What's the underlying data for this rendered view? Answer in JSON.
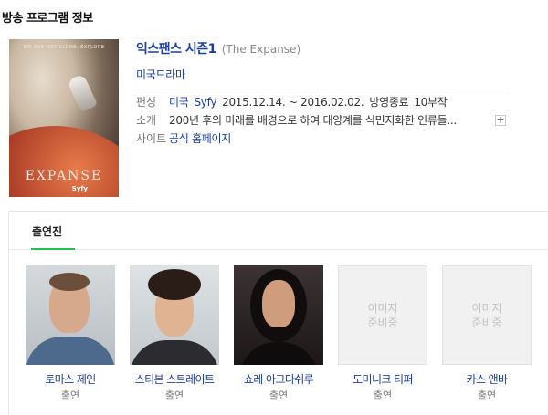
{
  "page": {
    "section_title": "방송 프로그램 정보"
  },
  "poster": {
    "tagline": "WE ARE NOT ALONE. EXPLORE",
    "logo": "EXPANSE",
    "network": "Syfy"
  },
  "program": {
    "title": "익스팬스 시즌1",
    "original_title": "(The Expanse)",
    "genre": "미국드라마"
  },
  "info": {
    "broadcast_label": "편성",
    "broadcast_country": "미국",
    "broadcast_channel": "Syfy",
    "broadcast_period": "2015.12.14. ~ 2016.02.02.",
    "broadcast_status": "방영종료",
    "broadcast_episodes": "10부작",
    "intro_label": "소개",
    "intro_text": "200년 후의 미래를 배경으로 하여 태양계를 식민지화한 인류들...",
    "more_icon_text": "+",
    "site_label": "사이트",
    "site_link": "공식 홈페이지"
  },
  "cast": {
    "tab_label": "출연진",
    "members": [
      {
        "name": "토마스 제인",
        "role": "출연",
        "has_photo": true
      },
      {
        "name": "스티븐 스트레이트",
        "role": "출연",
        "has_photo": true
      },
      {
        "name": "쇼레 아그다쉬루",
        "role": "출연",
        "has_photo": true
      },
      {
        "name": "도미니크 티퍼",
        "role": "출연",
        "has_photo": false,
        "placeholder": "이미지 준비중"
      },
      {
        "name": "카스 앤바",
        "role": "출연",
        "has_photo": false,
        "placeholder": "이미지 준비중"
      }
    ]
  }
}
